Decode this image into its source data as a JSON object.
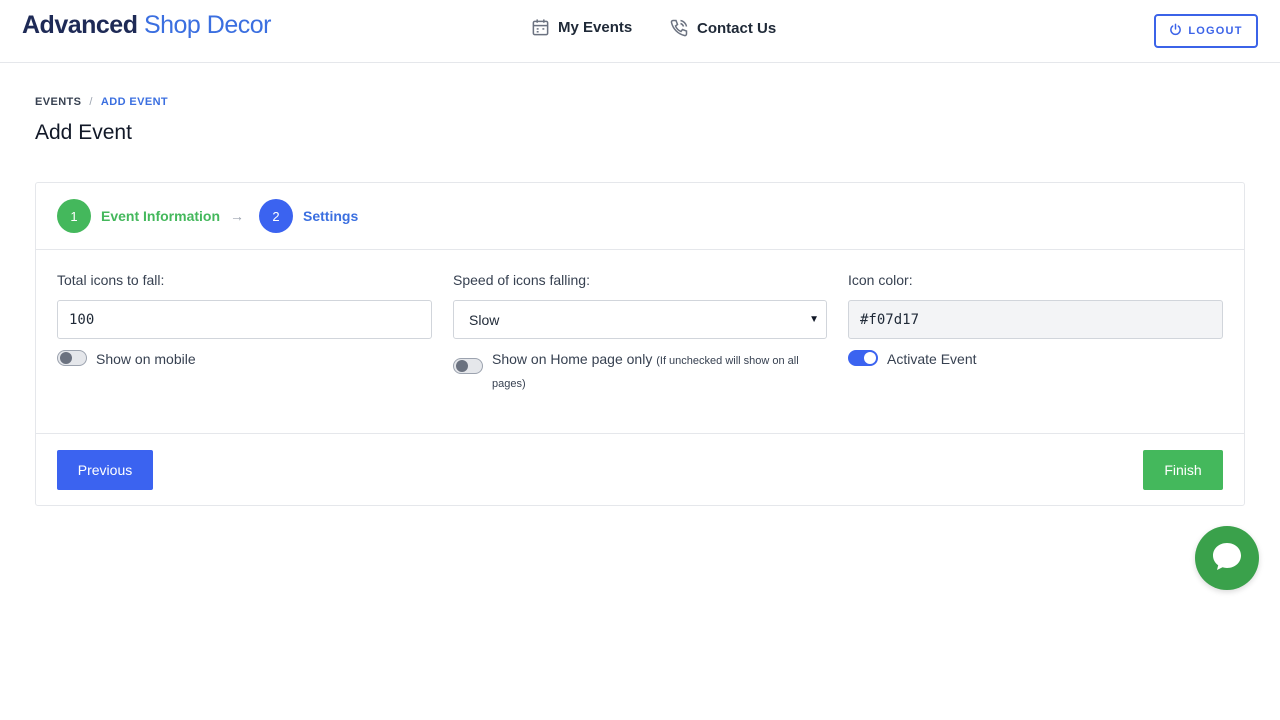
{
  "brand": {
    "bold": "Advanced",
    "light": "Shop Decor"
  },
  "nav": {
    "my_events": {
      "label": "My Events",
      "icon": "calendar-icon"
    },
    "contact_us": {
      "label": "Contact Us",
      "icon": "phone-icon"
    }
  },
  "logout": {
    "label": "LOGOUT",
    "icon": "power-icon"
  },
  "breadcrumb": {
    "root": "EVENTS",
    "separator": "/",
    "current": "ADD EVENT"
  },
  "page_title": "Add Event",
  "stepper": {
    "steps": [
      {
        "number": "1",
        "label": "Event Information",
        "state": "completed"
      },
      {
        "number": "2",
        "label": "Settings",
        "state": "active"
      }
    ],
    "arrow": "→"
  },
  "form": {
    "total_icons": {
      "label": "Total icons to fall:",
      "value": "100"
    },
    "speed": {
      "label": "Speed of icons falling:",
      "selected": "Slow",
      "caret": "▼"
    },
    "icon_color": {
      "label": "Icon color:",
      "value": "#f07d17"
    },
    "show_on_mobile": {
      "label": "Show on mobile",
      "checked": false
    },
    "home_only": {
      "label": "Show on Home page only",
      "hint": "(If unchecked will show on all pages)",
      "checked": false
    },
    "activate_event": {
      "label": "Activate Event",
      "checked": true
    }
  },
  "buttons": {
    "previous": "Previous",
    "finish": "Finish"
  },
  "chat": {
    "icon": "chat-bubble-icon"
  },
  "colors": {
    "primary": "#3b63f0",
    "success": "#44b85c",
    "brand_dark": "#1e2a56",
    "brand_blue": "#3b6fe0",
    "chat": "#3aa14b"
  }
}
